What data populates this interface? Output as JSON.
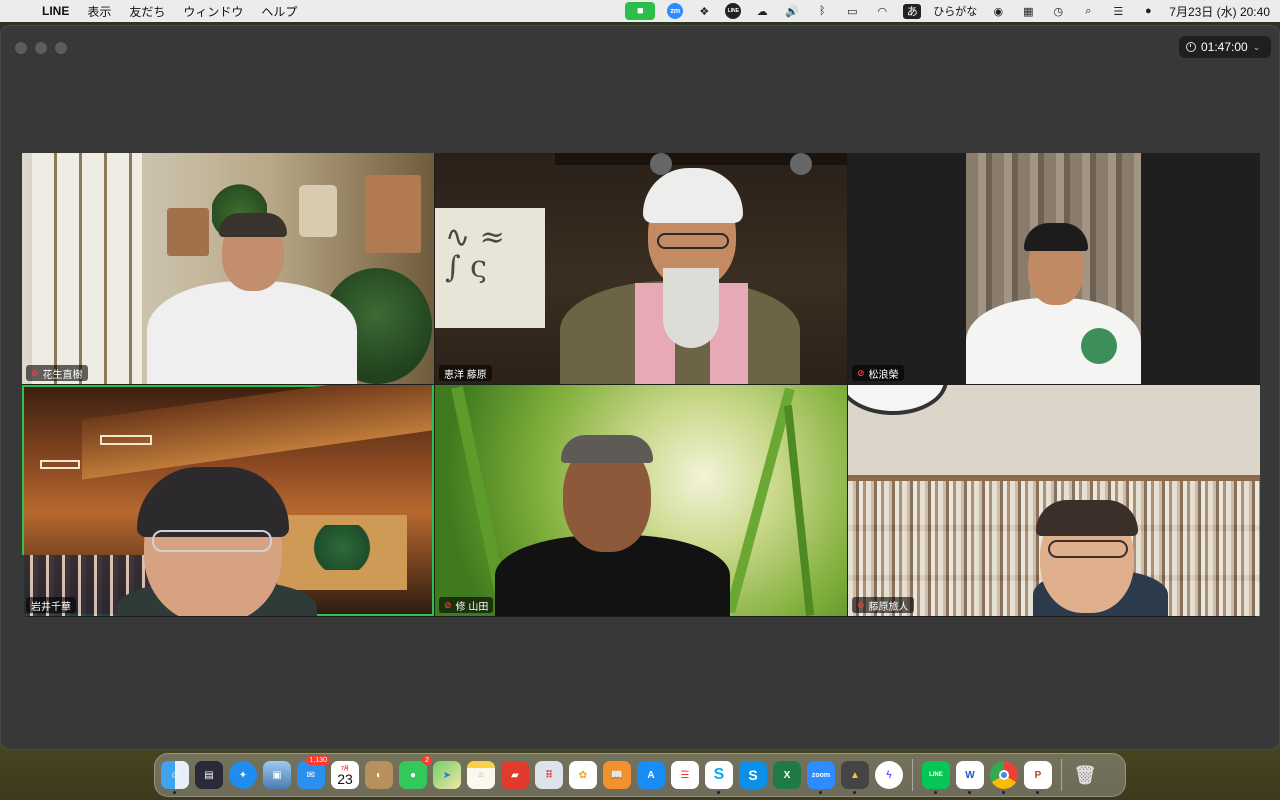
{
  "menubar": {
    "app_name": "LINE",
    "menus": [
      "表示",
      "友だち",
      "ウィンドウ",
      "ヘルプ"
    ],
    "ime_char": "あ",
    "ime_label": "ひらがな",
    "clock": "7月23日 (水)  20:40"
  },
  "call": {
    "timer": "01:47:00"
  },
  "participants": [
    {
      "name": "花生直樹",
      "muted": true,
      "active": false
    },
    {
      "name": "恵洋 藤原",
      "muted": false,
      "active": false
    },
    {
      "name": "松浪榮",
      "muted": true,
      "active": false
    },
    {
      "name": "岩井千華",
      "muted": false,
      "active": true
    },
    {
      "name": "修 山田",
      "muted": true,
      "active": false
    },
    {
      "name": "藤原旅人",
      "muted": true,
      "active": false
    }
  ],
  "dock": {
    "mail_badge": "1,130",
    "calendar_month": "7月",
    "calendar_day": "23",
    "messages_badge": "2",
    "zoom_label": "zoom",
    "line_label": "LINE",
    "word_label": "W",
    "excel_label": "X",
    "powerpoint_label": "P"
  },
  "colors": {
    "active_speaker": "#2ec24a",
    "muted": "#ff3b30",
    "window_bg": "#383838"
  }
}
